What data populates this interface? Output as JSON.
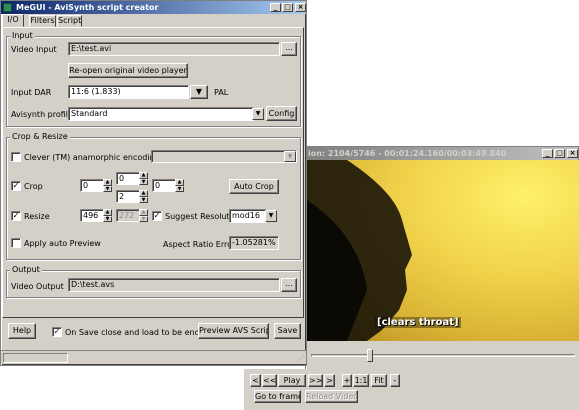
{
  "megui": {
    "title": "MeGUI - AviSynth script creator",
    "tabs": [
      "I/O",
      "Filters",
      "Script"
    ],
    "input_group": "Input",
    "video_input_label": "Video Input",
    "video_input_value": "E:\\test.avi",
    "browse_label": "...",
    "reopen_label": "Re-open original video player",
    "input_dar_label": "Input DAR",
    "input_dar_value": "11:6 (1.833)",
    "pal_label": "PAL",
    "avisynth_profile_label": "Avisynth profile",
    "avisynth_profile_value": "Standard",
    "config_label": "Config",
    "crop_group": "Crop & Resize",
    "clever_label": "Clever (TM) anamorphic encoding:",
    "crop_label": "Crop",
    "crop_left": "0",
    "crop_top": "0",
    "crop_bottom": "2",
    "crop_right": "0",
    "auto_crop_label": "Auto Crop",
    "resize_label": "Resize",
    "resize_width": "496",
    "resize_height": "272",
    "suggest_label": "Suggest Resolution",
    "mod_value": "mod16",
    "apply_preview_label": "Apply auto Preview",
    "aspect_error_label": "Aspect Ratio Error",
    "aspect_error_value": "-1.05281%",
    "output_group": "Output",
    "video_output_label": "Video Output",
    "video_output_value": "D:\\test.avs",
    "help_label": "Help",
    "on_save_label": "On Save close and load to be encoded",
    "preview_label": "Preview AVS Script",
    "save_label": "Save"
  },
  "preview": {
    "title": "ion: 2104/5746  -  00:01:24.160/00:03:49.840",
    "subtitle": "[clears throat]",
    "controls": [
      "<",
      "<<",
      "Play",
      ">>",
      ">",
      "+",
      "1:1",
      "Fit",
      "-"
    ],
    "goto_label": "Go to frame",
    "reload_label": "Reload Video"
  },
  "colors": {
    "title_active": "#0a246a",
    "title_inactive": "#808080",
    "face": "#d4d0c8"
  }
}
